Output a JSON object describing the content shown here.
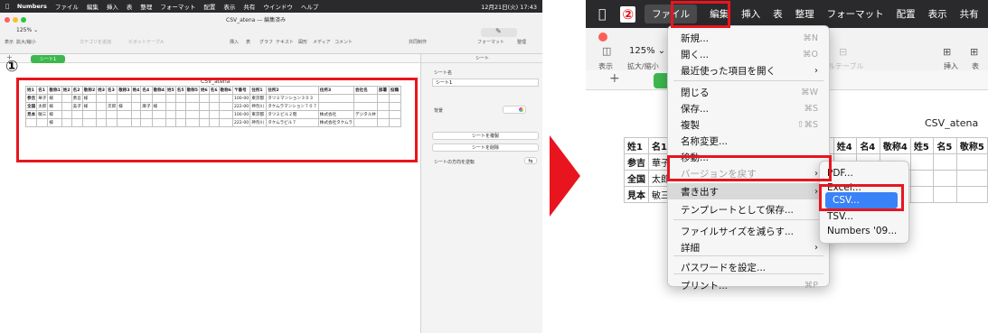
{
  "left": {
    "menubar": [
      "Numbers",
      "ファイル",
      "編集",
      "挿入",
      "表",
      "整理",
      "フォーマット",
      "配置",
      "表示",
      "共有",
      "ウインドウ",
      "ヘルプ"
    ],
    "menubar_right": "12月21日(火) 17:43",
    "doc_title": "CSV_atena — 編集済み",
    "zoom": "125%",
    "toolbar_labels": [
      "表示",
      "拡大/縮小",
      "カテゴリを追加",
      "ピボットテーブル",
      "挿入",
      "表",
      "グラフ",
      "テキスト",
      "図形",
      "メディア",
      "コメント",
      "共同制作",
      "フォーマット",
      "整理"
    ],
    "sheet_tab": "シート1",
    "sidebar_tab": "シート",
    "step_marker": "①",
    "table_title": "CSV_atena",
    "table": {
      "headers": [
        "姓1",
        "名1",
        "敬称1",
        "姓2",
        "名2",
        "敬称2",
        "姓3",
        "名3",
        "敬称3",
        "姓4",
        "名4",
        "敬称4",
        "姓5",
        "名5",
        "敬称5",
        "姓6",
        "名6",
        "敬称6",
        "〒番号",
        "住所1",
        "住所2",
        "住所3",
        "会社名",
        "部署",
        "役職"
      ],
      "rows": [
        [
          "参吉",
          "華子",
          "様",
          "",
          "勇吾",
          "様",
          "",
          "",
          "",
          "",
          "",
          "",
          "",
          "",
          "",
          "",
          "",
          "",
          "100-00",
          "東京都",
          "タツミマンション３０３",
          "",
          "",
          "",
          ""
        ],
        [
          "全国",
          "太郎",
          "様",
          "",
          "美子",
          "様",
          "",
          "次郎",
          "様",
          "",
          "麻子",
          "様",
          "",
          "",
          "",
          "",
          "",
          "",
          "222-00",
          "神奈川",
          "タケムラマンション７０７",
          "",
          "",
          "",
          ""
        ],
        [
          "見本",
          "敏三",
          "様",
          "",
          "",
          "",
          "",
          "",
          "",
          "",
          "",
          "",
          "",
          "",
          "",
          "",
          "",
          "",
          "100-00",
          "東京都",
          "タツミビル２階",
          "株式会社",
          "デジタル井",
          "",
          ""
        ],
        [
          "",
          "",
          "様",
          "",
          "",
          "",
          "",
          "",
          "",
          "",
          "",
          "",
          "",
          "",
          "",
          "",
          "",
          "",
          "222-00",
          "神奈川",
          "タケムラビル７",
          "株式会社タケムラ",
          "",
          "",
          ""
        ]
      ]
    },
    "side": {
      "name_label": "シート名",
      "name_value": "シート1",
      "bg_label": "背景",
      "duplicate": "シートを複製",
      "delete": "シートを削除",
      "direction": "シートの方向を逆転"
    }
  },
  "right": {
    "step_marker": "②",
    "menubar": [
      "ファイル",
      "編集",
      "挿入",
      "表",
      "整理",
      "フォーマット",
      "配置",
      "表示",
      "共有"
    ],
    "zoom": "125%",
    "toolbar_labels": [
      "表示",
      "拡大/縮小",
      "ブルテーブル",
      "挿入",
      "表"
    ],
    "sheet_tab": "シート1",
    "table_title": "CSV_atena",
    "table": {
      "headers": [
        "姓1",
        "名1",
        "",
        "",
        "",
        "",
        "",
        "",
        "",
        "姓3",
        "姓4",
        "名4",
        "敬称4",
        "姓5",
        "名5",
        "敬称5"
      ],
      "rows": [
        [
          "参吉",
          "華子"
        ],
        [
          "全国",
          "太郎"
        ],
        [
          "見本",
          "敏三"
        ]
      ]
    },
    "file_menu": [
      {
        "label": "新規...",
        "shortcut": "⌘N"
      },
      {
        "label": "開く...",
        "shortcut": "⌘O"
      },
      {
        "label": "最近使った項目を開く",
        "shortcut": "›"
      },
      {
        "label": "閉じる",
        "shortcut": "⌘W"
      },
      {
        "label": "保存...",
        "shortcut": "⌘S"
      },
      {
        "label": "複製",
        "shortcut": "⇧⌘S"
      },
      {
        "label": "名称変更...",
        "shortcut": ""
      },
      {
        "label": "移動...",
        "shortcut": ""
      },
      {
        "label": "バージョンを戻す",
        "shortcut": "›"
      },
      {
        "label": "書き出す",
        "shortcut": "›"
      },
      {
        "label": "テンプレートとして保存...",
        "shortcut": ""
      },
      {
        "label": "ファイルサイズを減らす...",
        "shortcut": ""
      },
      {
        "label": "詳細",
        "shortcut": "›"
      },
      {
        "label": "パスワードを設定...",
        "shortcut": ""
      },
      {
        "label": "プリント...",
        "shortcut": "⌘P"
      }
    ],
    "export_menu": [
      "PDF...",
      "Excel...",
      "CSV...",
      "TSV...",
      "Numbers '09..."
    ]
  },
  "colors": {
    "highlight": "#e8151e",
    "sheet_tab": "#3db84f",
    "menu_selected": "#3a82f7"
  }
}
